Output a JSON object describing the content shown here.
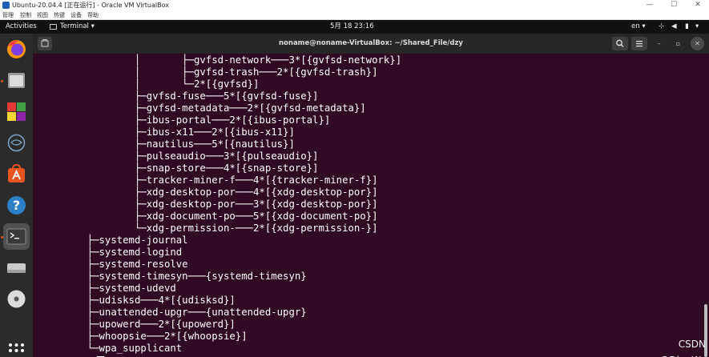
{
  "vbox": {
    "title": "Ubuntu-20.04.4 [正在运行] - Oracle VM VirtualBox",
    "menus": [
      "管理",
      "控制",
      "视图",
      "热键",
      "设备",
      "帮助"
    ]
  },
  "topbar": {
    "activities": "Activities",
    "app_menu": "Terminal",
    "clock": "5月 18  23:16",
    "language": "en"
  },
  "dock": {
    "apps": [
      {
        "name": "Firefox",
        "icon": "firefox-icon"
      },
      {
        "name": "Files",
        "icon": "files-icon"
      },
      {
        "name": "Software Center",
        "icon": "software-icon"
      },
      {
        "name": "Deepin",
        "icon": "deepin-icon"
      },
      {
        "name": "Ubuntu Software",
        "icon": "ubuntu-software-icon"
      },
      {
        "name": "Help",
        "icon": "help-icon"
      },
      {
        "name": "Terminal",
        "icon": "terminal-icon"
      },
      {
        "name": "Disk",
        "icon": "disk-icon"
      },
      {
        "name": "DVD",
        "icon": "dvd-icon"
      },
      {
        "name": "Show Applications",
        "icon": "grid-icon"
      }
    ]
  },
  "terminal": {
    "title": "noname@noname-VirtualBox: ~/Shared_File/dzy",
    "lines": [
      "                │       ├─gvfsd-network───3*[{gvfsd-network}]",
      "                │       ├─gvfsd-trash───2*[{gvfsd-trash}]",
      "                │       └─2*[{gvfsd}]",
      "                ├─gvfsd-fuse───5*[{gvfsd-fuse}]",
      "                ├─gvfsd-metadata───2*[{gvfsd-metadata}]",
      "                ├─ibus-portal───2*[{ibus-portal}]",
      "                ├─ibus-x11───2*[{ibus-x11}]",
      "                ├─nautilus───5*[{nautilus}]",
      "                ├─pulseaudio───3*[{pulseaudio}]",
      "                ├─snap-store───4*[{snap-store}]",
      "                ├─tracker-miner-f───4*[{tracker-miner-f}]",
      "                ├─xdg-desktop-por───4*[{xdg-desktop-por}]",
      "                ├─xdg-desktop-por───3*[{xdg-desktop-por}]",
      "                ├─xdg-document-po───5*[{xdg-document-po}]",
      "                └─xdg-permission-───2*[{xdg-permission-}]",
      "        ├─systemd-journal",
      "        ├─systemd-logind",
      "        ├─systemd-resolve",
      "        ├─systemd-timesyn───{systemd-timesyn}",
      "        ├─systemd-udevd",
      "        ├─udisksd───4*[{udisksd}]",
      "        ├─unattended-upgr───{unattended-upgr}",
      "        ├─upowerd───2*[{upowerd}]",
      "        ├─whoopsie───2*[{whoopsie}]",
      "        └─wpa_supplicant"
    ]
  },
  "watermark": "CSDN @DingW_",
  "colors": {
    "terminal_bg": "#300a24",
    "ubuntu_orange": "#e95420"
  }
}
